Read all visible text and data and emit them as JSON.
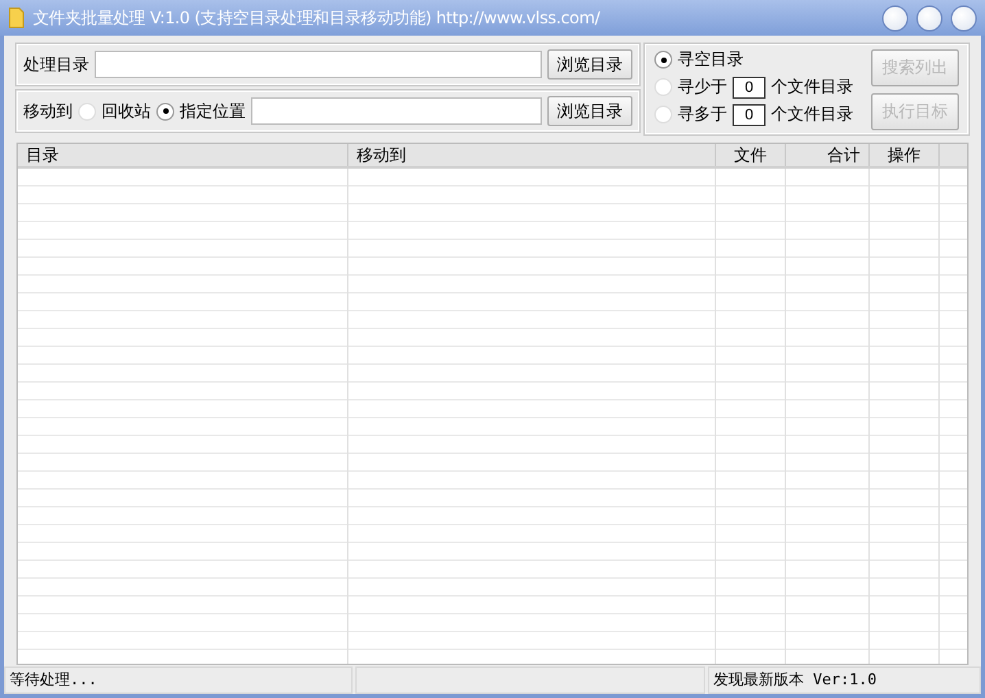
{
  "window": {
    "title": "文件夹批量处理 V:1.0 (支持空目录处理和目录移动功能) http://www.vlss.com/"
  },
  "source": {
    "label": "处理目录",
    "browse": "浏览目录"
  },
  "move_to": {
    "label": "移动到",
    "options": [
      {
        "label": "回收站",
        "selected": false
      },
      {
        "label": "指定位置",
        "selected": true
      }
    ],
    "browse": "浏览目录"
  },
  "search_modes": [
    {
      "kind": "plain",
      "label": "寻空目录",
      "selected": true
    },
    {
      "kind": "count",
      "label": "寻少于",
      "count": "0",
      "suffix": "个文件目录",
      "selected": false
    },
    {
      "kind": "count",
      "label": "寻多于",
      "count": "0",
      "suffix": "个文件目录",
      "selected": false
    }
  ],
  "actions": [
    {
      "label": "搜索列出",
      "disabled": true
    },
    {
      "label": "执行目标",
      "disabled": true
    }
  ],
  "table": {
    "columns": [
      {
        "label": "目录"
      },
      {
        "label": "移动到"
      },
      {
        "label": "文件"
      },
      {
        "label": "合计"
      },
      {
        "label": "操作"
      }
    ]
  },
  "status_bar": {
    "left": "等待处理...",
    "right": "发现最新版本 Ver:1.0"
  }
}
